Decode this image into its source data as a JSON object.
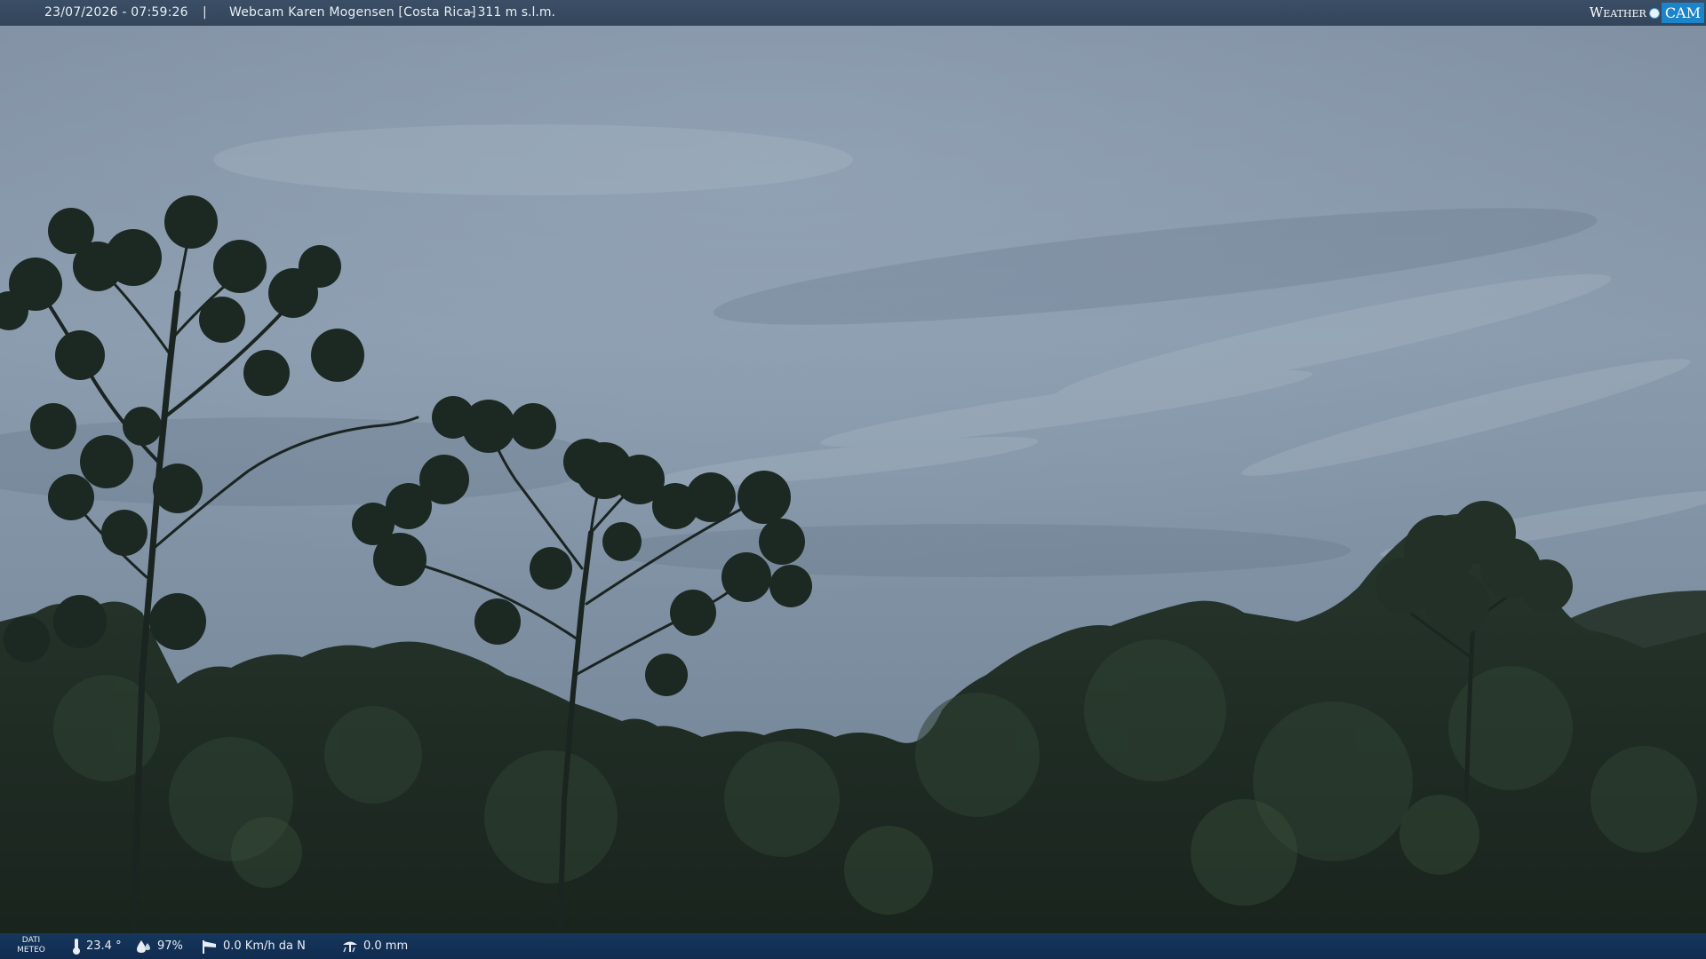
{
  "header": {
    "timestamp": "23/07/2026 - 07:59:26",
    "separator": "|",
    "title": "Webcam Karen Mogensen [Costa Rica]",
    "altitude": "- 311 m s.l.m."
  },
  "logo": {
    "word": "Weather",
    "cam": "CAM"
  },
  "weather": {
    "label_line1": "DATI",
    "label_line2": "METEO",
    "temperature": "23.4 °",
    "humidity": "97%",
    "wind": "0.0 Km/h da N",
    "rain": "0.0 mm"
  },
  "icons": {
    "temperature": "thermometer-icon",
    "humidity": "humidity-drop-icon",
    "wind": "windsock-icon",
    "rain": "rain-gauge-icon"
  },
  "colors": {
    "sky_top": "#8695a6",
    "sky_mid": "#7d90a3",
    "forest": "#1f2b24",
    "bar_top": "#344860",
    "bar_bottom": "#16386a",
    "logo_accent": "#1c84c8"
  }
}
